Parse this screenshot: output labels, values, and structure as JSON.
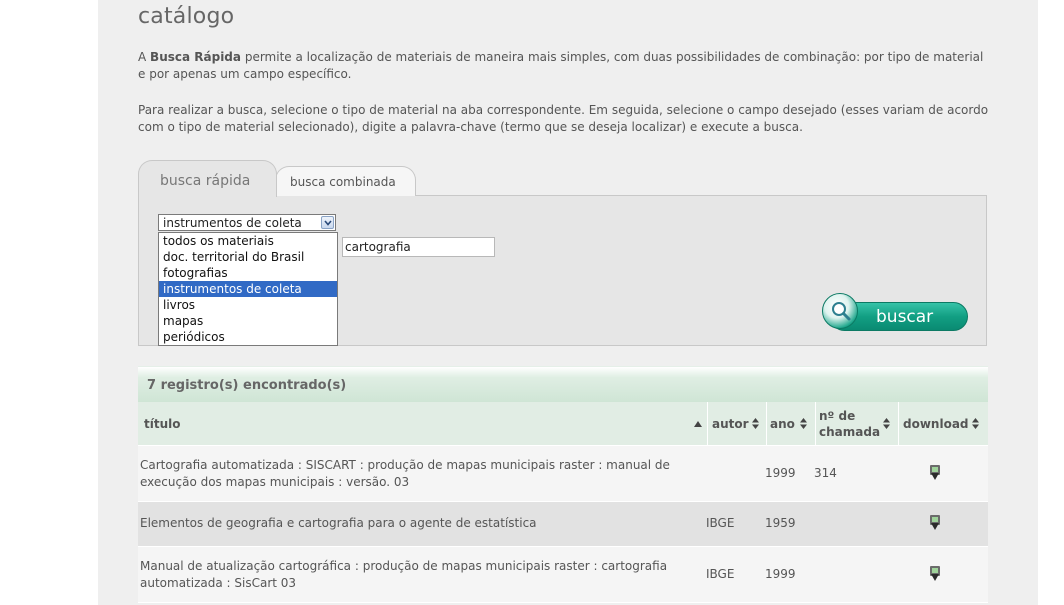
{
  "page": {
    "title": "catálogo",
    "para1_bold": "Busca Rápida",
    "para1_prefix": "A",
    "para1_rest": "permite a localização de materiais de maneira mais simples, com duas possibilidades de combinação: por tipo de material e por apenas um campo específico.",
    "para2": "Para realizar a busca, selecione o tipo de material na aba correspondente. Em seguida, selecione o campo desejado (esses variam de acordo com o tipo de material selecionado), digite a palavra-chave (termo que se deseja localizar) e execute a busca."
  },
  "tabs": [
    {
      "label": "busca rápida",
      "active": true
    },
    {
      "label": "busca combinada",
      "active": false
    }
  ],
  "search": {
    "material_select_value": "instrumentos de coleta",
    "dropdown_options": [
      "todos os materiais",
      "doc. territorial do Brasil",
      "fotografias",
      "instrumentos de coleta",
      "livros",
      "mapas",
      "periódicos"
    ],
    "selected_option": "instrumentos de coleta",
    "keyword_value": "cartografia",
    "button_label": "buscar"
  },
  "results": {
    "count_label": "7 registro(s) encontrado(s)",
    "columns": [
      "título",
      "autor",
      "ano",
      "nº de chamada",
      "download"
    ],
    "rows": [
      {
        "titulo": "Cartografia automatizada : SISCART : produção de mapas municipais raster : manual de execução dos mapas municipais : versão. 03",
        "autor": "",
        "ano": "1999",
        "chamada": "314"
      },
      {
        "titulo": "Elementos de geografia e cartografia para o agente de estatística",
        "autor": "IBGE",
        "ano": "1959",
        "chamada": ""
      },
      {
        "titulo": "Manual de atualização cartográfica : produção de mapas municipais raster : cartografia automatizada : SisCart 03",
        "autor": "IBGE",
        "ano": "1999",
        "chamada": ""
      }
    ]
  },
  "colors": {
    "accent": "#129f83",
    "selection": "#316ac5",
    "header_bg": "#e1ede4"
  }
}
